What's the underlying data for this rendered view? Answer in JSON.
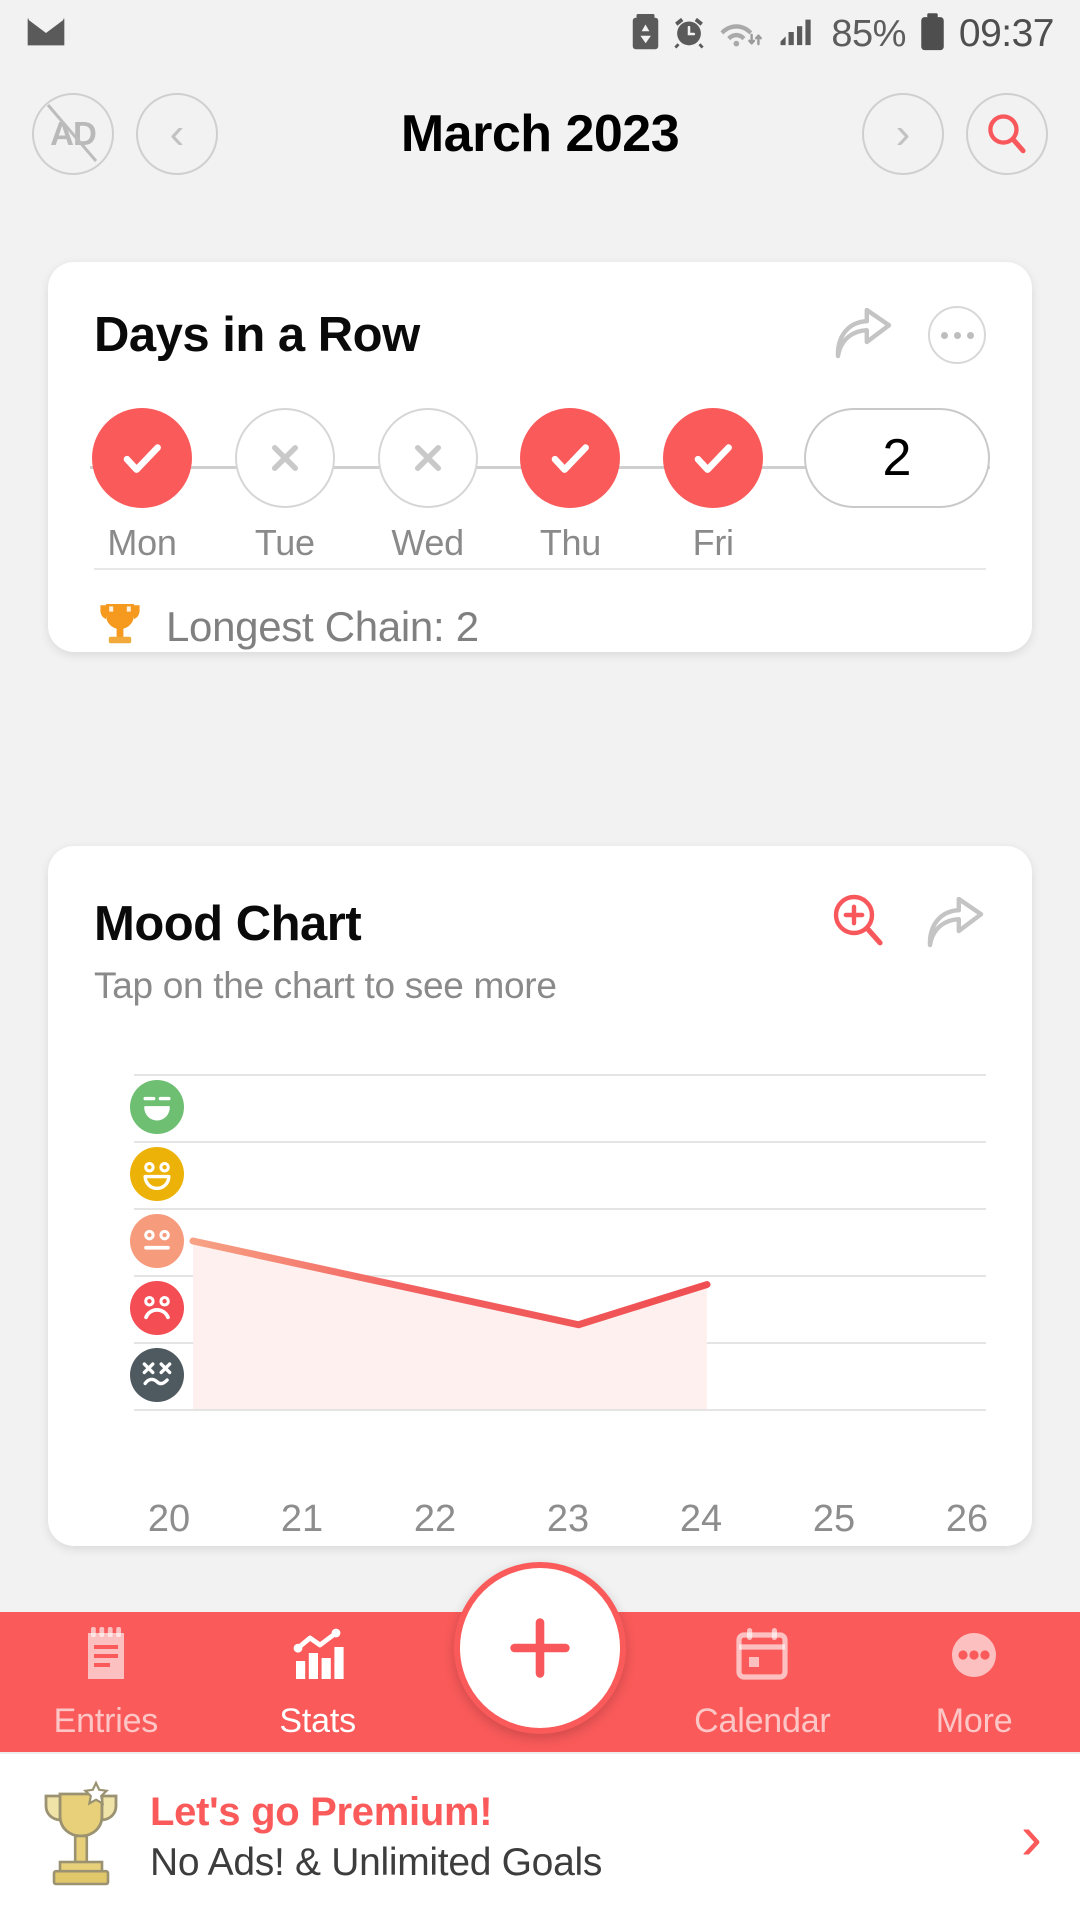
{
  "status_bar": {
    "mail_icon": "mail-icon",
    "battery_saver_icon": "battery-saver-icon",
    "alarm_icon": "alarm-icon",
    "wifi_icon": "wifi-icon",
    "signal_icon": "signal-icon",
    "battery_percent": "85%",
    "battery_icon": "battery-icon",
    "time": "09:37"
  },
  "header": {
    "ad_button_label": "AD",
    "prev_label": "‹",
    "title": "March 2023",
    "next_label": "›",
    "search_icon": "search-icon"
  },
  "streak_card": {
    "title": "Days in a Row",
    "share_icon": "share-icon",
    "more_icon": "more-options-icon",
    "days": [
      {
        "label": "Mon",
        "state": "done",
        "glyph": "✓"
      },
      {
        "label": "Tue",
        "state": "miss",
        "glyph": "✕"
      },
      {
        "label": "Wed",
        "state": "miss",
        "glyph": "✕"
      },
      {
        "label": "Thu",
        "state": "done",
        "glyph": "✓"
      },
      {
        "label": "Fri",
        "state": "done",
        "glyph": "✓"
      }
    ],
    "streak_count": "2",
    "trophy_icon": "trophy-icon",
    "longest_chain_text": "Longest Chain: 2"
  },
  "mood_card": {
    "title": "Mood Chart",
    "subtitle": "Tap on the chart to see more",
    "zoom_icon": "zoom-in-icon",
    "share_icon": "share-icon"
  },
  "chart_data": {
    "type": "line",
    "title": "Mood Chart",
    "subtitle": "Tap on the chart to see more",
    "xlabel": "",
    "ylabel": "",
    "x": [
      20,
      21,
      22,
      23,
      24,
      25,
      26
    ],
    "xtick_labels": [
      "20",
      "21",
      "22",
      "23",
      "24",
      "25",
      "26"
    ],
    "ytick_labels": [
      "awesome",
      "good",
      "meh",
      "bad",
      "awful"
    ],
    "ylim": [
      1,
      5
    ],
    "grid": true,
    "legend": "none",
    "mood_levels": [
      {
        "name": "awesome",
        "value": 5,
        "color": "#6fbf73",
        "face": "grin"
      },
      {
        "name": "good",
        "value": 4,
        "color": "#edb208",
        "face": "smile"
      },
      {
        "name": "meh",
        "value": 3,
        "color": "#f79b7d",
        "face": "neutral"
      },
      {
        "name": "bad",
        "value": 2,
        "color": "#f44d54",
        "face": "frown"
      },
      {
        "name": "awful",
        "value": 1,
        "color": "#4f5a60",
        "face": "dead"
      }
    ],
    "series": [
      {
        "name": "Mood",
        "x": [
          20,
          23,
          24
        ],
        "values": [
          3.0,
          1.75,
          2.35
        ],
        "line_color": "#f05a5a",
        "fill_color": "#fdf0ee"
      }
    ]
  },
  "bottom_nav": {
    "items": [
      {
        "label": "Entries",
        "icon": "notepad-icon",
        "active": false
      },
      {
        "label": "Stats",
        "icon": "bar-chart-icon",
        "active": true
      },
      {
        "label": "Calendar",
        "icon": "calendar-icon",
        "active": false
      },
      {
        "label": "More",
        "icon": "more-dots-icon",
        "active": false
      }
    ],
    "fab": {
      "label": "+",
      "icon": "plus-icon"
    }
  },
  "premium_banner": {
    "trophy_icon": "trophy-gold-icon",
    "title": "Let's go Premium!",
    "subtitle": "No Ads! & Unlimited Goals",
    "chevron": "›"
  },
  "colors": {
    "accent": "#fa5a5a",
    "background": "#f2f2f2",
    "card": "#ffffff",
    "muted_text": "#8a8a8a"
  }
}
